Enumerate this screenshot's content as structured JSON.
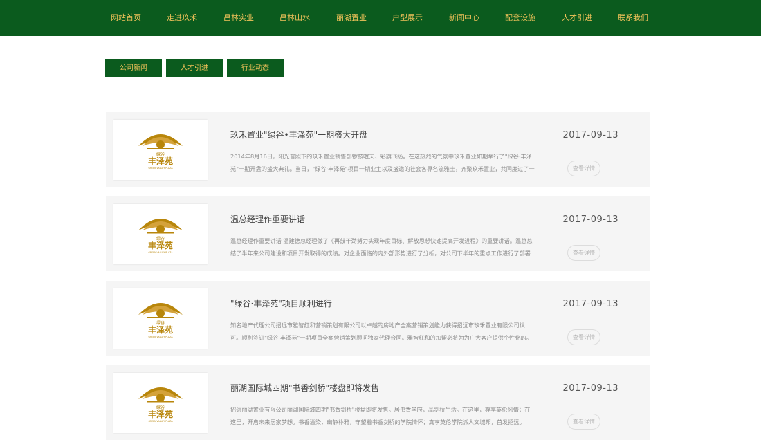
{
  "nav": {
    "items": [
      {
        "label": "网站首页"
      },
      {
        "label": "走进玖禾"
      },
      {
        "label": "昌林实业"
      },
      {
        "label": "昌林山水"
      },
      {
        "label": "丽湖置业"
      },
      {
        "label": "户型展示"
      },
      {
        "label": "新闻中心"
      },
      {
        "label": "配套设施"
      },
      {
        "label": "人才引进"
      },
      {
        "label": "联系我们"
      }
    ]
  },
  "tabs": [
    {
      "label": "公司新闻"
    },
    {
      "label": "人才引进"
    },
    {
      "label": "行业动态"
    }
  ],
  "logo": {
    "cn_small": "绿谷",
    "cn_big": "丰泽苑",
    "en": "GREEN VALLEY PLAZA",
    "color": "#b8860b"
  },
  "news": [
    {
      "title": "玖禾置业\"绿谷•丰泽苑\"一期盛大开盘",
      "excerpt": "2014年8月16日，阳光普照下的玖禾置业销售部锣鼓喧天、彩旗飞扬。在这热烈的气氛中玖禾置业如期举行了\"绿谷·丰泽苑\"一期开盘的盛大典礼。当日，\"绿谷·丰泽苑\"项目一期业主以及盛邀的社会各界名流雅士，齐聚玖禾置业，共同度过了一",
      "date": "2017-09-13",
      "more": "查看详情"
    },
    {
      "title": "温总经理作重要讲话",
      "excerpt": "温总经理作重要讲话 温建德总经理做了《再鼓干劲努力实现年度目标、解放思想快速提高开发进程》的重要讲话。温总总结了半年来公司建设和项目开发取得的成绩。对企业面临的内外部形势进行了分析，对公司下半年的重点工作进行了部署",
      "date": "2017-09-13",
      "more": "查看详情"
    },
    {
      "title": "\"绿谷·丰泽苑\"项目顺利进行",
      "excerpt": "知名地产代理公司招远市雅智红和营销策划有限公司以卓越的房地产全案营销策划能力获得招远市玖禾置业有限公司认可。顺利签订\"绿谷·丰泽苑\"一期项目全案营销策划顾问独家代理合同。雅智红和的加盟必将为为广大客户提供个性化的。",
      "date": "2017-09-13",
      "more": "查看详情"
    },
    {
      "title": "丽湖国际城四期\"书香剑桥\"楼盘即将发售",
      "excerpt": "招远丽湖置业有限公司丽湖国际城四期\"书香剑桥\"楼盘即将发售。居书香学府，品剑桥生活。在这里，尊享英伦风情；在这里，开启未来居家梦想。书香溢染，幽静朴雅，守望着书香剑桥的学院情怀；真享英伦学院派人文城邦，首发招远。",
      "date": "2017-09-13",
      "more": "查看详情"
    }
  ]
}
